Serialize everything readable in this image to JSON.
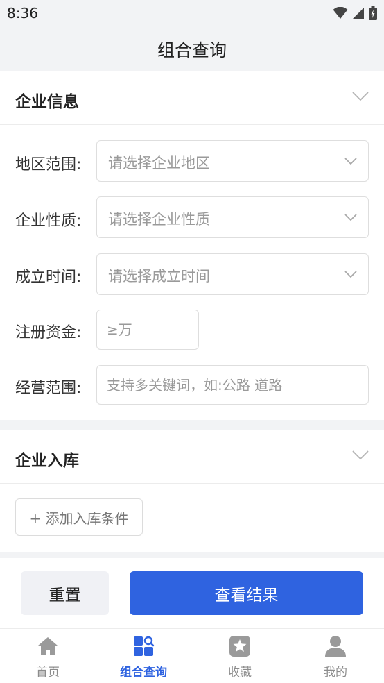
{
  "status_bar": {
    "time": "8:36"
  },
  "nav": {
    "title": "组合查询"
  },
  "enterprise_info": {
    "title": "企业信息",
    "region": {
      "label": "地区范围:",
      "placeholder": "请选择企业地区"
    },
    "nature": {
      "label": "企业性质:",
      "placeholder": "请选择企业性质"
    },
    "founded": {
      "label": "成立时间:",
      "placeholder": "请选择成立时间"
    },
    "capital": {
      "label": "注册资金:",
      "placeholder": "≥万"
    },
    "scope": {
      "label": "经营范围:",
      "placeholder": "支持多关键词，如:公路 道路"
    }
  },
  "enterprise_storage": {
    "title": "企业入库",
    "add_condition": "+ 添加入库条件"
  },
  "actions": {
    "reset": "重置",
    "view_results": "查看结果"
  },
  "tabs": [
    {
      "label": "首页",
      "icon": "home-icon",
      "active": false
    },
    {
      "label": "组合查询",
      "icon": "combined-query-icon",
      "active": true
    },
    {
      "label": "收藏",
      "icon": "favorites-star-icon",
      "active": false
    },
    {
      "label": "我的",
      "icon": "user-profile-icon",
      "active": false
    }
  ],
  "colors": {
    "accent": "#2f63e0",
    "inactive_tab": "#8c8c8c",
    "background": "#f2f3f5"
  }
}
